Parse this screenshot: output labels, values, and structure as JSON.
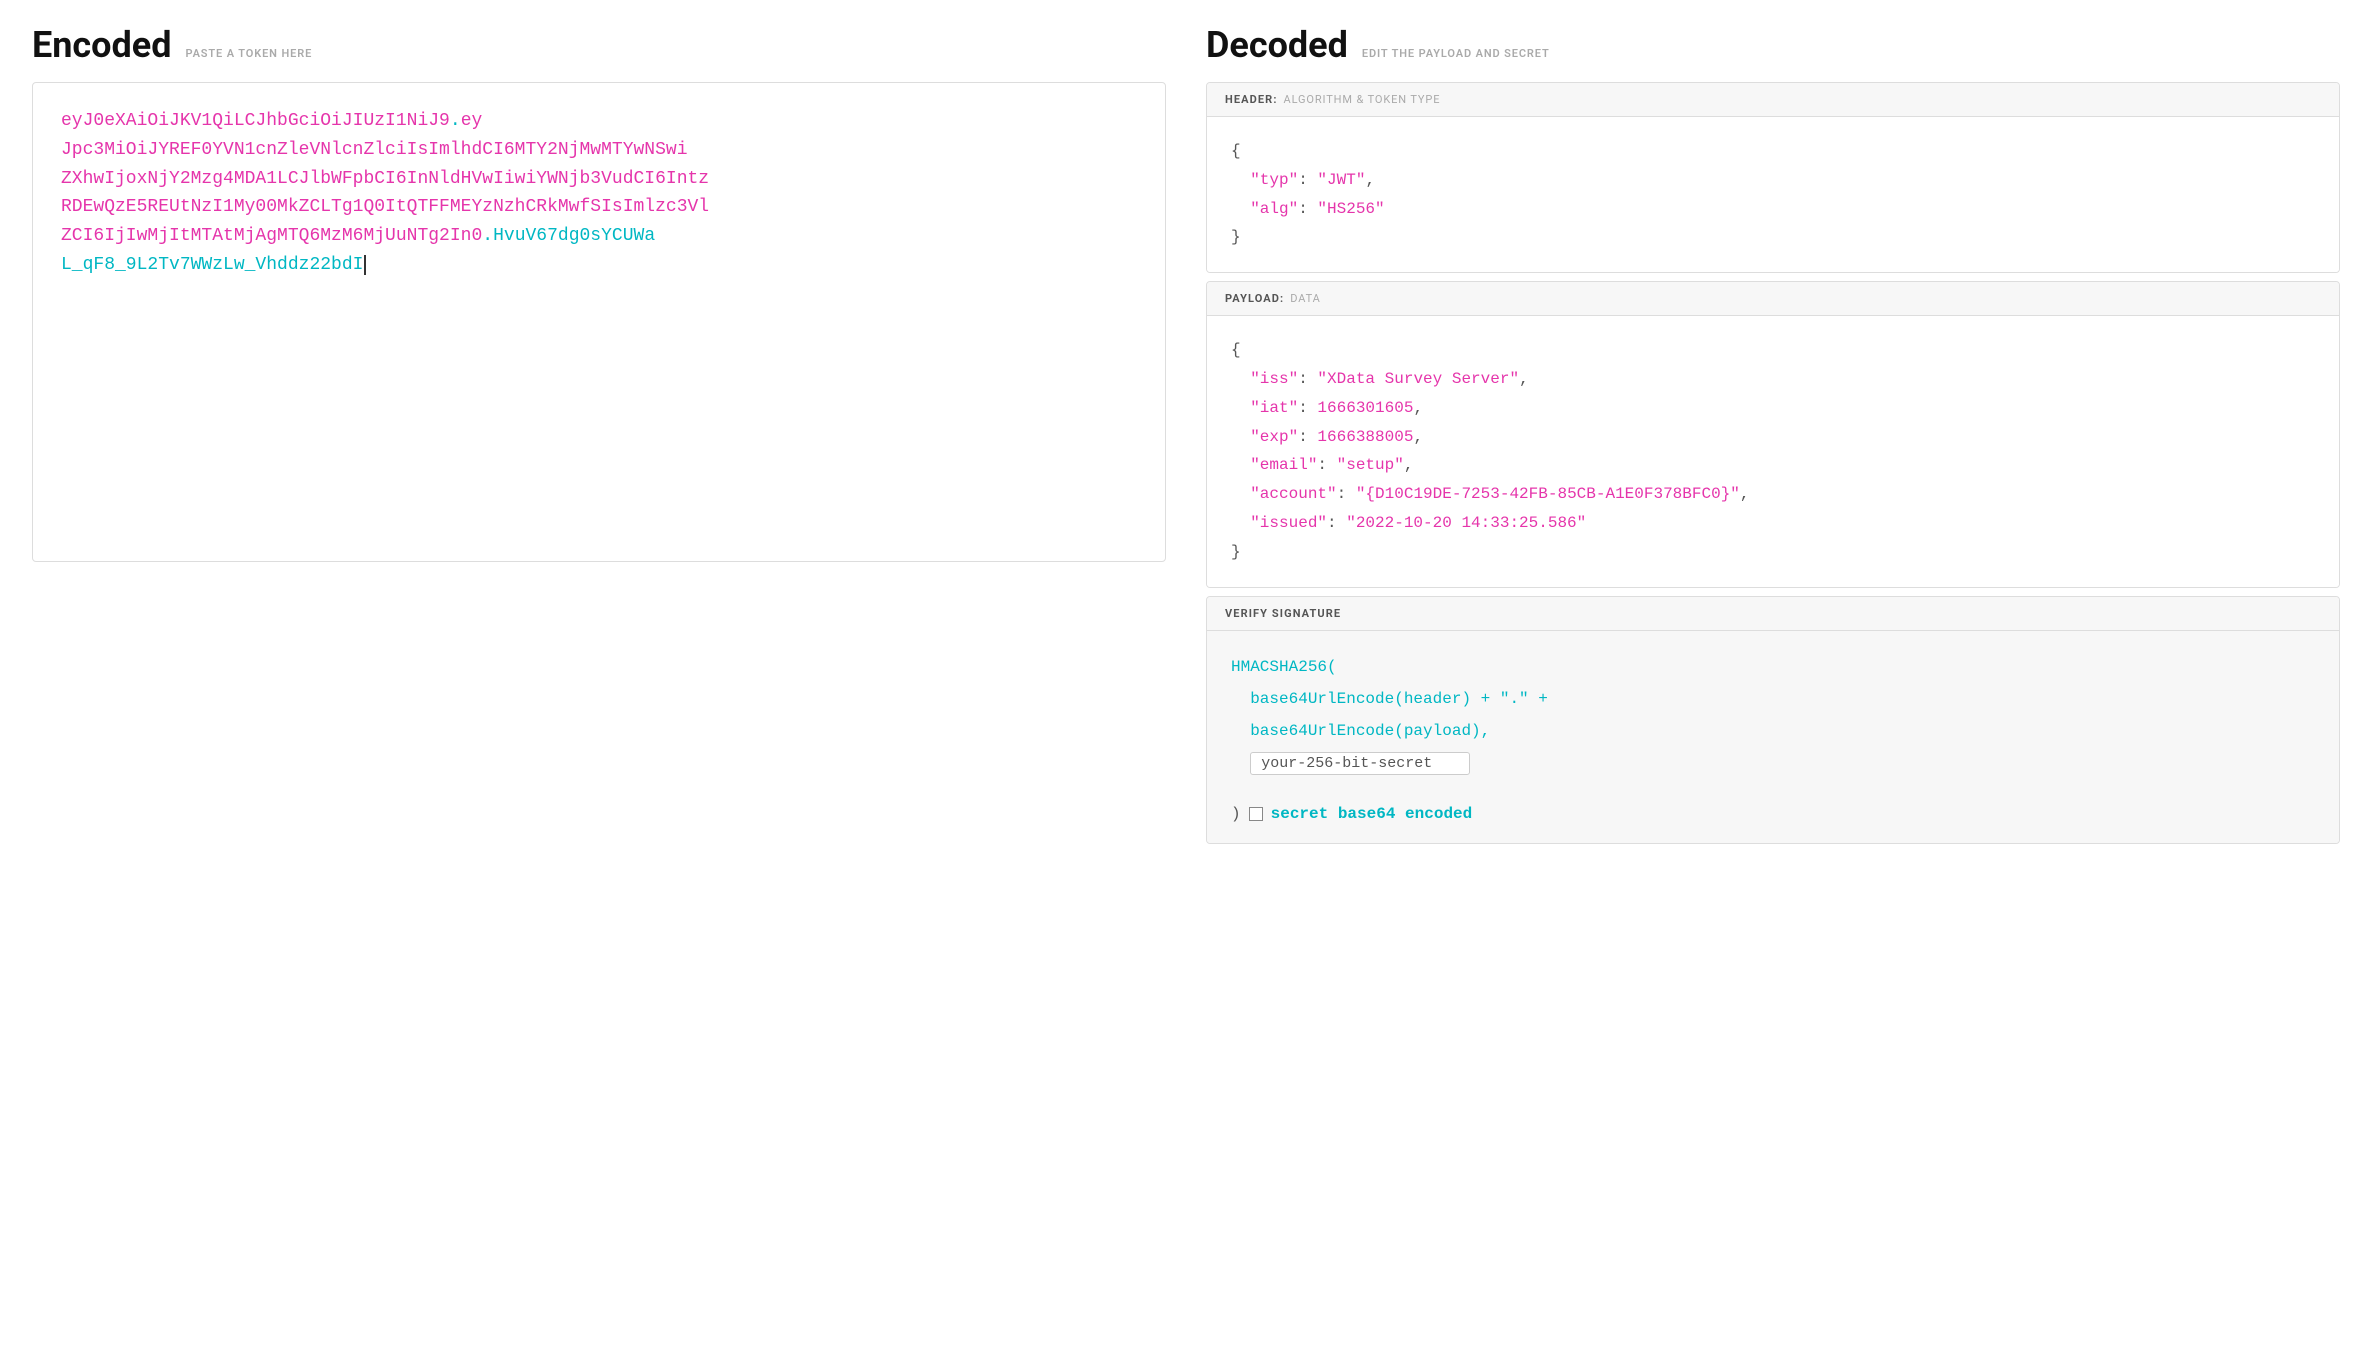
{
  "encoded": {
    "title": "Encoded",
    "subtitle": "PASTE A TOKEN HERE",
    "token": {
      "header_b64": "eyJ0eXAiOiJKV1QiLCJhbGciOiJIUzI1NiJ9",
      "dot1": ".",
      "payload_b64": "eyJpc3MiOiJYREF0YVN1cnZleVNlcnZlciIsImlhdCI6MTY2NjMwMTYwNSwi\nZXhwIjoxNjY2Mzg4MDA1LCJlbWFpbCI6InNldHVwIiwiYWNjb3VudCI6Intz\nRDEwQzE5REUtNzI1My00MkZCLTg1Q0ItQTFFMEYzNzhCRkMwfSIsImlzc3Vl\nZCI6IjIwMjItMTAtMjAgMTQ6MzM6MjUuNTg2In0",
      "dot2": ".",
      "sig": "HvuV67dg0sYCUWaL_qF8_9L2Tv7WWzLw_Vhddz22bdI"
    },
    "display_lines": [
      {
        "parts": [
          {
            "text": "eyJ0eXAiOiJKV1QiLCJhbGciOiJIUzI1NiJ9",
            "color": "header"
          },
          {
            "text": ".",
            "color": "dot"
          },
          {
            "text": "ey",
            "color": "payload"
          }
        ]
      },
      {
        "parts": [
          {
            "text": "Jpc3MiOiJYREF0YVN1cnZleVNlcnZlciIsImlhdCI6MTY2NjMwMTYwNSwi",
            "color": "payload"
          }
        ]
      },
      {
        "parts": [
          {
            "text": "ZXhwIjoxNjY2Mzg4MDA1LCJlbWFpbCI6InNldHVwIiwiYWNjb3VudCI6Intz",
            "color": "payload"
          }
        ]
      },
      {
        "parts": [
          {
            "text": "RDEwQzE5REUtNzI1My00MkZCLTg1Q0ItQTFFMEYzNzhCRkMwfSIsImlzc3Vl",
            "color": "payload"
          }
        ]
      },
      {
        "parts": [
          {
            "text": "ZCI6IjIwMjItMTAtMjAgMTQ6MzM6MjUuNTg2In0",
            "color": "payload"
          },
          {
            "text": ".",
            "color": "dot"
          },
          {
            "text": "HvuV67dg0sYCUWa",
            "color": "sig"
          }
        ]
      },
      {
        "parts": [
          {
            "text": "L_qF8_9L2Tv7WWzLw_Vhddz22bdI",
            "color": "sig"
          }
        ],
        "cursor": true
      }
    ]
  },
  "decoded": {
    "title": "Decoded",
    "subtitle": "EDIT THE PAYLOAD AND SECRET",
    "header_panel": {
      "label": "HEADER:",
      "sublabel": "ALGORITHM & TOKEN TYPE",
      "content": {
        "typ": "JWT",
        "alg": "HS256"
      }
    },
    "payload_panel": {
      "label": "PAYLOAD:",
      "sublabel": "DATA",
      "content": {
        "iss": "XData Survey Server",
        "iat": 1666301605,
        "exp": 1666388005,
        "email": "setup",
        "account": "{D10C19DE-7253-42FB-85CB-A1E0F378BFC0}",
        "issued": "2022-10-20 14:33:25.586"
      }
    },
    "verify_panel": {
      "label": "VERIFY SIGNATURE",
      "fn_name": "HMACSHA256(",
      "line1": "base64UrlEncode(header) + \".\" +",
      "line2": "base64UrlEncode(payload),",
      "secret_placeholder": "your-256-bit-secret",
      "close_paren": ")",
      "b64_label": "secret base64 encoded"
    }
  }
}
